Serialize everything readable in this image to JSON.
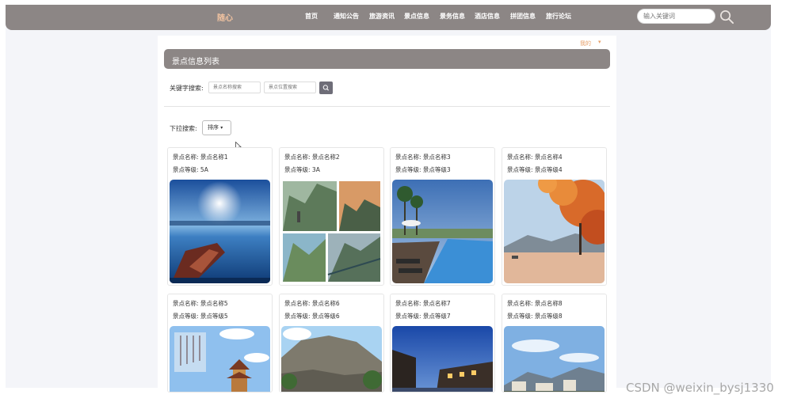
{
  "header": {
    "brand": "随心",
    "nav": [
      "首页",
      "通知公告",
      "旅游资讯",
      "景点信息",
      "景务信息",
      "酒店信息",
      "拼团信息",
      "旅行论坛"
    ],
    "search_placeholder": "输入关键词"
  },
  "user_menu": {
    "label": "我的",
    "caret": "▾"
  },
  "page": {
    "title": "景点信息列表",
    "keyword_label": "关键字搜索:",
    "name_placeholder": "景点名称搜索",
    "location_placeholder": "景点位置搜索",
    "dropdown_label": "下拉搜索:",
    "sort_label": "排序",
    "sort_caret": "▾"
  },
  "cards": [
    {
      "name_label": "景点名称:",
      "name": "景点名称1",
      "level_label": "景点等级:",
      "level": "5A",
      "image": "lake-sunset-boat"
    },
    {
      "name_label": "景点名称:",
      "name": "景点名称2",
      "level_label": "景点等级:",
      "level": "3A",
      "image": "mountain-cliff-collage"
    },
    {
      "name_label": "景点名称:",
      "name": "景点名称3",
      "level_label": "景点等级:",
      "level": "景点等级3",
      "image": "resort-pool"
    },
    {
      "name_label": "景点名称:",
      "name": "景点名称4",
      "level_label": "景点等级:",
      "level": "景点等级4",
      "image": "autumn-lake"
    },
    {
      "name_label": "景点名称:",
      "name": "景点名称5",
      "level_label": "景点等级:",
      "level": "景点等级5",
      "image": "pagoda-calligraphy"
    },
    {
      "name_label": "景点名称:",
      "name": "景点名称6",
      "level_label": "景点等级:",
      "level": "景点等级6",
      "image": "rock-mountain"
    },
    {
      "name_label": "景点名称:",
      "name": "景点名称7",
      "level_label": "景点等级:",
      "level": "景点等级7",
      "image": "night-old-town"
    },
    {
      "name_label": "景点名称:",
      "name": "景点名称8",
      "level_label": "景点等级:",
      "level": "景点等级8",
      "image": "blue-sky-town"
    }
  ],
  "watermark": "CSDN @weixin_bysj1330",
  "colors": {
    "header_bg": "#8c8685",
    "brand": "#f0c2a0",
    "accent": "#e7a06a",
    "search_btn": "#6e6d78"
  }
}
